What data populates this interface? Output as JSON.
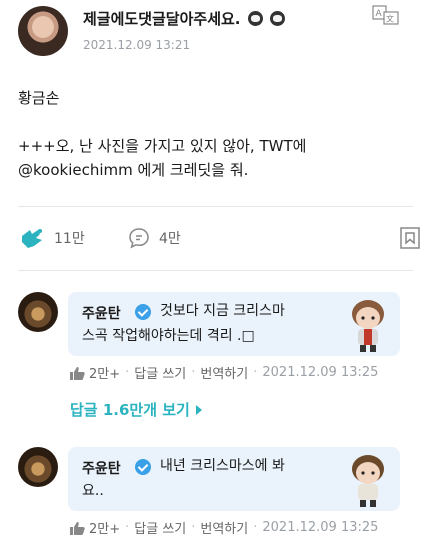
{
  "post": {
    "author": "제글에도댓글달아주세요.",
    "date": "2021.12.09 13:21",
    "body_line1": "황금손",
    "body_line2": "+++오, 난 사진을 가지고 있지 않아, TWT에",
    "body_line3": "@kookiechimm 에게 크레딧을 줘."
  },
  "actions": {
    "likes": "11만",
    "comments": "4만"
  },
  "comments": [
    {
      "name": "주윤탄",
      "text_line1": "것보다 지금 크리스마",
      "text_line2": "스곡 작업해야하는데 격리 .□",
      "likes": "2만+",
      "reply_label": "답글 쓰기",
      "translate_label": "번역하기",
      "date": "2021.12.09 13:25"
    },
    {
      "name": "주윤탄",
      "text_line1": "내년 크리스마스에 봐",
      "text_line2": "요..",
      "likes": "2만+",
      "reply_label": "답글 쓰기",
      "translate_label": "번역하기",
      "date": "2021.12.09 13:25"
    }
  ],
  "replies_link": "답글 1.6만개 보기",
  "colors": {
    "accent": "#2bb3c0",
    "bubble": "#eaf3fb",
    "badge": "#3aa0e8"
  }
}
